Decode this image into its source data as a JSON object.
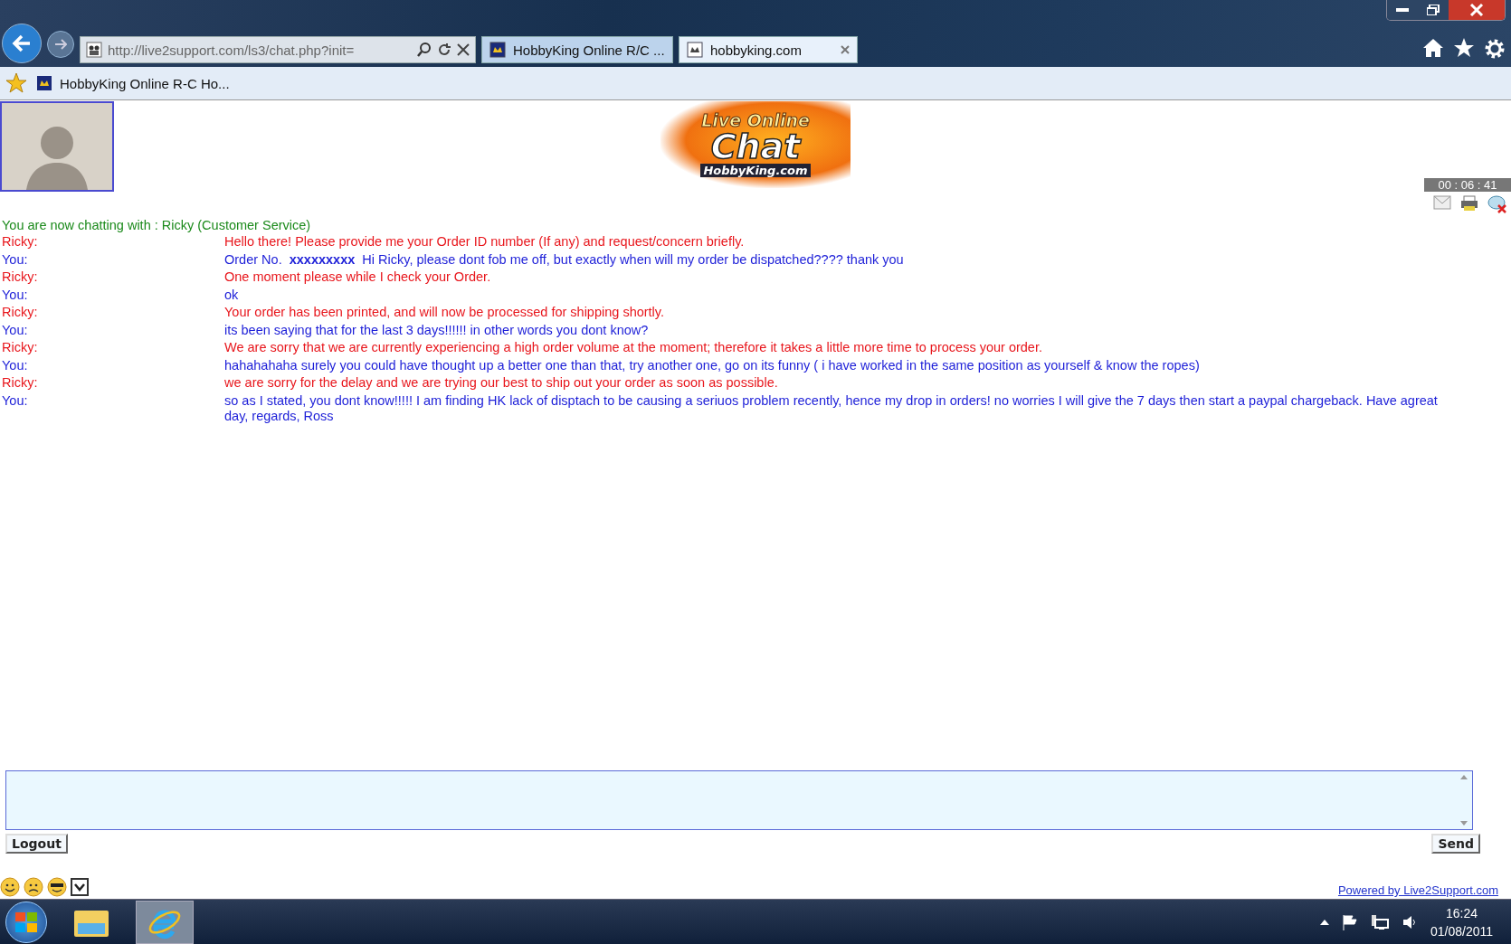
{
  "browser": {
    "url": "http://live2support.com/ls3/chat.php?init=",
    "tabs": [
      {
        "label": "HobbyKing Online R/C ...",
        "selected": false
      },
      {
        "label": "hobbyking.com",
        "selected": true
      }
    ],
    "favorites": [
      "HobbyKing Online R-C Ho..."
    ]
  },
  "logo": {
    "line1": "Live Online",
    "line2": "Chat",
    "line3": "HobbyKing.com"
  },
  "timer": "00 : 06 : 41",
  "chat": {
    "intro": "You are now chatting with : Ricky (Customer Service)",
    "messages": [
      {
        "sender": "Ricky:",
        "kind": "agent",
        "text": "Hello there! Please provide me your Order ID number (If any) and request/concern briefly."
      },
      {
        "sender": "You:",
        "kind": "customer",
        "text": "Order No.  **xxxxxxxxx**  Hi Ricky, please dont fob me off, but exactly when will my order be dispatched???? thank you"
      },
      {
        "sender": "Ricky:",
        "kind": "agent",
        "text": "One moment please while I check your Order."
      },
      {
        "sender": "You:",
        "kind": "customer",
        "text": "ok"
      },
      {
        "sender": "Ricky:",
        "kind": "agent",
        "text": "Your order has been printed, and will now be processed for shipping shortly."
      },
      {
        "sender": "You:",
        "kind": "customer",
        "text": "its been saying that for the last 3 days!!!!!! in other words you dont know?"
      },
      {
        "sender": "Ricky:",
        "kind": "agent",
        "text": "We are sorry that we are currently experiencing a high order volume at the moment; therefore it takes a little more time to process your order."
      },
      {
        "sender": "You:",
        "kind": "customer",
        "text": "hahahahaha surely you could have thought up a better one than that, try another one, go on its funny ( i have worked in the same position as yourself & know the ropes)"
      },
      {
        "sender": "Ricky:",
        "kind": "agent",
        "text": "we are sorry for the delay and we are trying our best to ship out your order as soon as possible."
      },
      {
        "sender": "You:",
        "kind": "customer",
        "text": "so as I stated, you dont know!!!!! I am finding HK lack of disptach to be causing a seriuos problem recently, hence my drop in orders! no worries I will give the 7 days then start a paypal chargeback. Have agreat day, regards, Ross"
      }
    ]
  },
  "buttons": {
    "logout": "Logout",
    "send": "Send"
  },
  "powered_by": "Powered by Live2Support.com",
  "taskbar": {
    "time": "16:24",
    "date": "01/08/2011"
  }
}
